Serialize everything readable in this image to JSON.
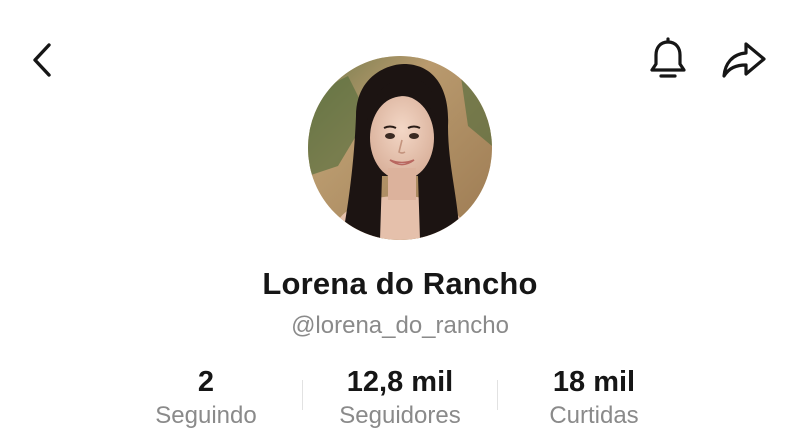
{
  "header": {
    "back_icon": "chevron-left-icon",
    "bell_icon": "bell-icon",
    "share_icon": "share-arrow-icon"
  },
  "profile": {
    "name": "Lorena do Rancho",
    "handle": "@lorena_do_rancho"
  },
  "stats": [
    {
      "value": "2",
      "label": "Seguindo"
    },
    {
      "value": "12,8 mil",
      "label": "Seguidores"
    },
    {
      "value": "18 mil",
      "label": "Curtidas"
    }
  ],
  "colors": {
    "text_primary": "#161616",
    "text_secondary": "#8a8a8a",
    "divider": "#e2e2e2",
    "background": "#ffffff"
  }
}
